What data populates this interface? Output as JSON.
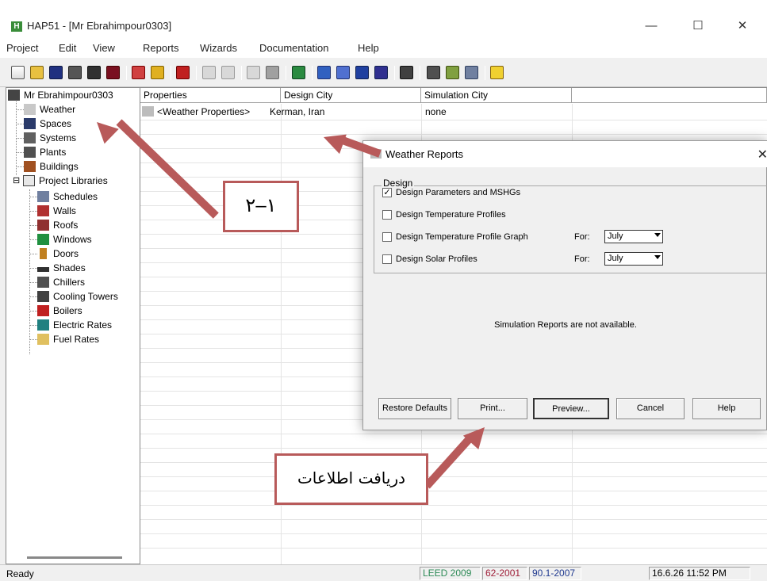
{
  "window": {
    "title": "HAP51 - [Mr Ebrahimpour0303]",
    "icon": "hap-app-icon",
    "minimize": "—",
    "maximize": "☐",
    "close": "✕"
  },
  "menu": [
    "Project",
    "Edit",
    "View",
    "Reports",
    "Wizards",
    "Documentation",
    "Help"
  ],
  "tree": {
    "root": "Mr Ebrahimpour0303",
    "items": [
      "Weather",
      "Spaces",
      "Systems",
      "Plants",
      "Buildings"
    ],
    "libraries_label": "Project Libraries",
    "expander": "⊟",
    "libraries": [
      "Schedules",
      "Walls",
      "Roofs",
      "Windows",
      "Doors",
      "Shades",
      "Chillers",
      "Cooling Towers",
      "Boilers",
      "Electric Rates",
      "Fuel Rates"
    ]
  },
  "list": {
    "columns": [
      "Properties",
      "Design City",
      "Simulation City"
    ],
    "rows": [
      {
        "properties": "<Weather Properties>",
        "design_city": "Kerman, Iran",
        "simulation_city": "none"
      }
    ]
  },
  "dialog": {
    "title": "Weather Reports",
    "close": "✕",
    "group_label": "Design",
    "options": [
      {
        "label": "Design Parameters and MSHGs",
        "checked": true
      },
      {
        "label": "Design Temperature Profiles",
        "checked": false
      },
      {
        "label": "Design Temperature Profile Graph",
        "checked": false,
        "for_label": "For:",
        "month": "July"
      },
      {
        "label": "Design Solar Profiles",
        "checked": false,
        "for_label": "For:",
        "month": "July"
      }
    ],
    "check_mark": "✓",
    "simulation_note": "Simulation Reports are not available.",
    "buttons": {
      "restore": "Restore Defaults",
      "print": "Print...",
      "preview": "Preview...",
      "cancel": "Cancel",
      "help": "Help"
    }
  },
  "status": {
    "text": "Ready",
    "leed": "LEED 2009",
    "std_62": "62-2001",
    "std_90": "90.1-2007",
    "datetime": "16.6.26  11:52 PM"
  },
  "annotations": {
    "label_1": "۲–۱",
    "label_2": "دریافت اطلاعات"
  },
  "colors": {
    "annotation": "#b85a5a",
    "leed_text": "#2e8b57",
    "std62_text": "#a0203a",
    "std90_text": "#203a90"
  }
}
